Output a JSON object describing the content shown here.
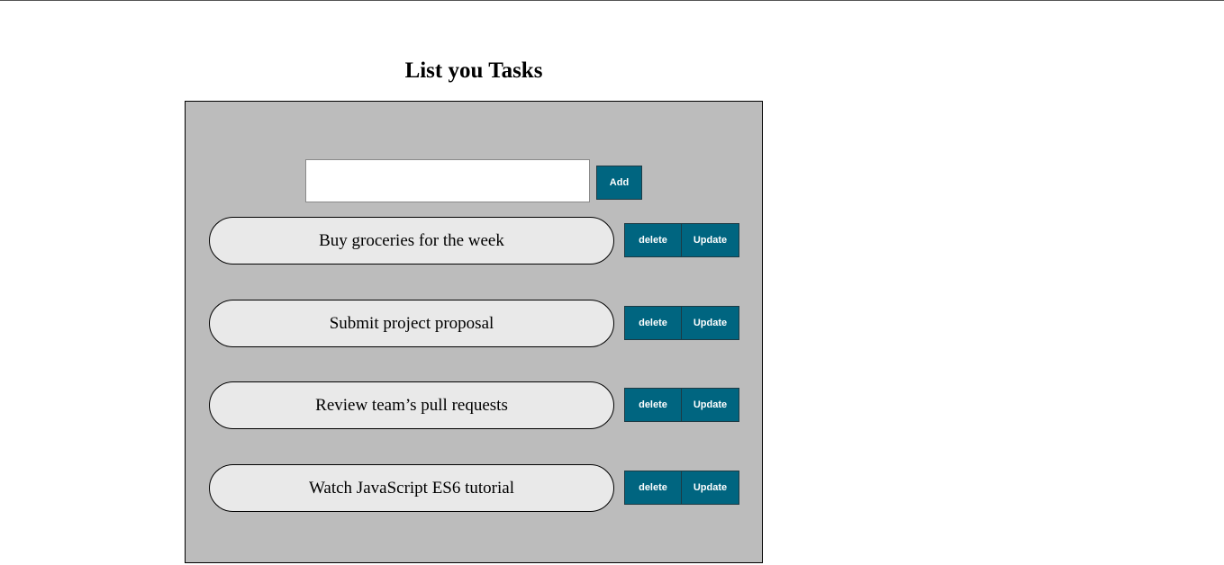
{
  "page": {
    "title": "List you Tasks"
  },
  "form": {
    "input_value": "",
    "input_placeholder": "",
    "add_label": "Add"
  },
  "tasks": [
    {
      "text": "Buy groceries for the week",
      "delete_label": "delete",
      "update_label": "Update"
    },
    {
      "text": "Submit project proposal",
      "delete_label": "delete",
      "update_label": "Update"
    },
    {
      "text": "Review team’s pull requests",
      "delete_label": "delete",
      "update_label": "Update"
    },
    {
      "text": "Watch JavaScript ES6 tutorial",
      "delete_label": "delete",
      "update_label": "Update"
    }
  ],
  "colors": {
    "panel_background": "#bcbcbc",
    "button_background": "#006580",
    "button_text": "#ffffff",
    "task_pill_background": "#e9e9e9"
  }
}
